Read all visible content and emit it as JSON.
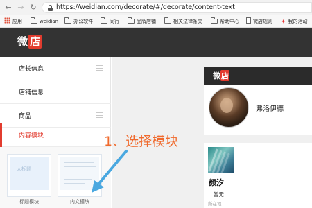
{
  "browser": {
    "url": "https://weidian.com/decorate/#/decorate/content-text",
    "back_icon": "arrow-left-icon",
    "forward_icon": "arrow-right-icon",
    "reload_icon": "reload-icon"
  },
  "bookmarks": [
    {
      "label": "应用",
      "icon": "apps-grid-icon"
    },
    {
      "label": "weidian",
      "icon": "folder-icon"
    },
    {
      "label": "办公软件",
      "icon": "folder-icon"
    },
    {
      "label": "同行",
      "icon": "folder-icon"
    },
    {
      "label": "品牌店铺",
      "icon": "folder-icon"
    },
    {
      "label": "相关法律条文",
      "icon": "folder-icon"
    },
    {
      "label": "帮助中心",
      "icon": "folder-icon"
    },
    {
      "label": "微店规则",
      "icon": "page-icon"
    },
    {
      "label": "我的活动",
      "icon": "butterfly-icon"
    }
  ],
  "header": {
    "logo_text": "微",
    "logo_badge": "店"
  },
  "sidebar": {
    "items": [
      {
        "label": "店长信息"
      },
      {
        "label": "店铺信息"
      },
      {
        "label": "商品"
      },
      {
        "label": "内容模块",
        "active": true
      }
    ]
  },
  "modules": {
    "tiles": [
      {
        "caption": "标题模块",
        "preview_text": "大标题"
      },
      {
        "caption": "内文模块"
      }
    ]
  },
  "annotation": {
    "text": "1、选择模块",
    "color": "#f06a2d"
  },
  "preview": {
    "logo_text": "微",
    "logo_badge": "店",
    "profile_name": "弗洛伊德",
    "card": {
      "title": "颜汐",
      "status": "暂无",
      "location": "所在地"
    }
  },
  "colors": {
    "accent": "#e23c2f",
    "header_bg": "#333333",
    "annotation": "#f06a2d",
    "arrow": "#4aa8e0"
  }
}
